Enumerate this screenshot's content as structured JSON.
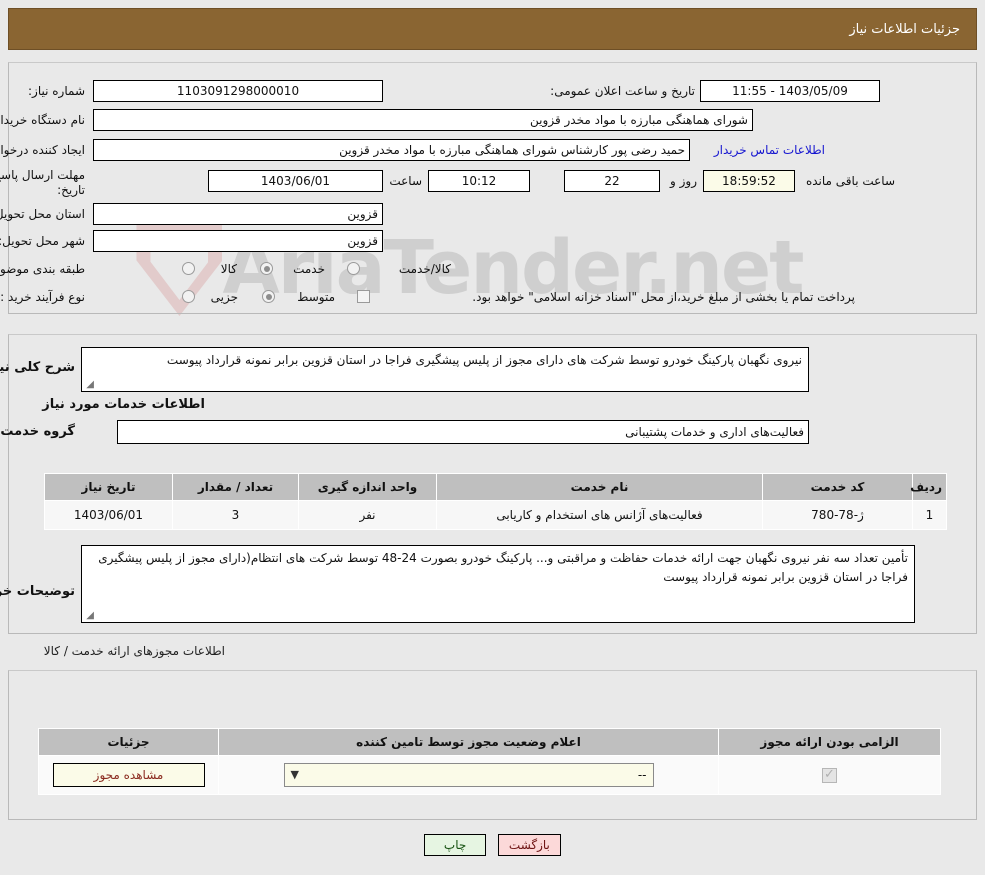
{
  "header": {
    "title": "جزئیات اطلاعات نیاز"
  },
  "watermark": {
    "text": "AriaTender.net"
  },
  "top_panel": {
    "need_number": {
      "label": "شماره نیاز:",
      "value": "1103091298000010"
    },
    "announce_datetime": {
      "label": "تاریخ و ساعت اعلان عمومی:",
      "value": "1403/05/09 - 11:55"
    },
    "buyer_org": {
      "label": "نام دستگاه خریدار:",
      "value": "شورای هماهنگی مبارزه با مواد مخدر قزوین"
    },
    "request_creator": {
      "label": "ایجاد کننده درخواست:",
      "value": "حمید رضی پور کارشناس شورای هماهنگی مبارزه با مواد مخدر قزوین"
    },
    "buyer_contact_link": "اطلاعات تماس خریدار",
    "deadline": {
      "label": "مهلت ارسال پاسخ: تا تاریخ:",
      "date": "1403/06/01",
      "time_label": "ساعت",
      "time": "10:12",
      "days": "22",
      "days_label": "روز و",
      "countdown": "18:59:52",
      "remaining_label": "ساعت باقی مانده"
    },
    "delivery_province": {
      "label": "استان محل تحویل:",
      "value": "قزوین"
    },
    "delivery_city": {
      "label": "شهر محل تحویل:",
      "value": "قزوین"
    },
    "category": {
      "label": "طبقه بندی موضوعی:",
      "options": [
        "کالا",
        "خدمت",
        "کالا/خدمت"
      ],
      "selected": "خدمت"
    },
    "purchase_type": {
      "label": "نوع فرآیند خرید :",
      "options": [
        "جزیی",
        "متوسط"
      ],
      "selected": "متوسط",
      "checkbox_note": "پرداخت تمام یا بخشی از مبلغ خرید،از محل \"اسناد خزانه اسلامی\" خواهد بود.",
      "checkbox_checked": false
    }
  },
  "description_panel": {
    "general_need": {
      "label": "شرح کلی نیاز:",
      "value": "نیروی نگهبان پارکینگ خودرو توسط شرکت های دارای مجوز از پلیس پیشگیری فراجا در استان قزوین برابر نمونه قرارداد پیوست"
    },
    "services_title": "اطلاعات خدمات مورد نیاز",
    "service_group": {
      "label": "گروه خدمت:",
      "value": "فعالیت‌های اداری و خدمات پشتیبانی"
    },
    "services_table": {
      "columns": [
        "ردیف",
        "کد خدمت",
        "نام خدمت",
        "واحد اندازه گیری",
        "تعداد / مقدار",
        "تاریخ نیاز"
      ],
      "rows": [
        {
          "row": "1",
          "code": "ژ-78-780",
          "name": "فعالیت‌های آژانس های استخدام و کاریابی",
          "unit": "نفر",
          "quantity": "3",
          "need_date": "1403/06/01"
        }
      ]
    },
    "buyer_notes": {
      "label": "توضیحات خریدار:",
      "value": "تأمین تعداد سه نفر نیروی نگهبان جهت ارائه خدمات حفاظت و مراقبتی و... پارکینگ خودرو بصورت 24-48 توسط شرکت های انتظام(دارای مجوز از پلیس پیشگیری فراجا در استان قزوین برابر نمونه قرارداد پیوست"
    }
  },
  "licenses": {
    "caption": "اطلاعات مجوزهای ارائه خدمت / کالا",
    "columns": [
      "الزامی بودن ارائه مجوز",
      "اعلام وضعیت مجوز توسط تامین کننده",
      "جزئیات"
    ],
    "rows": [
      {
        "required": true,
        "status_value": "--",
        "details_button": "مشاهده مجوز"
      }
    ]
  },
  "footer": {
    "back_button": "بازگشت",
    "print_button": "چاپ"
  },
  "colors": {
    "header_bar": "#8a6532",
    "page_background": "#e9e9e9",
    "link": "#1515d0",
    "back_button": "#fcd9d9",
    "print_button": "#e6f5e2",
    "cream_field": "#fbfbe8"
  }
}
